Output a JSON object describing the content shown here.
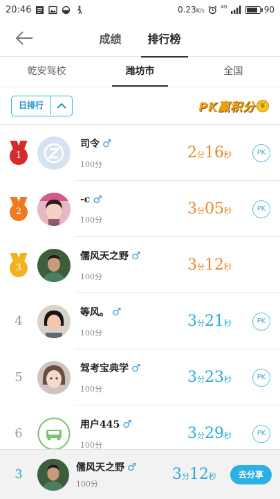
{
  "status_bar": {
    "time": "20:46",
    "speed": "0.23",
    "speed_unit": "K/s",
    "network": "4G",
    "battery": "90",
    "battery_level": 0.9
  },
  "header": {
    "back_icon": "arrow-left-icon",
    "tabs": [
      {
        "label": "成绩",
        "active": false
      },
      {
        "label": "排行榜",
        "active": true
      }
    ]
  },
  "region_tabs": [
    {
      "label": "乾安驾校",
      "active": false
    },
    {
      "label": "潍坊市",
      "active": true
    },
    {
      "label": "全国",
      "active": false
    }
  ],
  "filter": {
    "label": "日排行",
    "arrow_icon": "chevron-up-icon"
  },
  "banner": {
    "text": "PK赢积分",
    "coin": "¥"
  },
  "rankings": [
    {
      "rank": "1",
      "medal": "gold-red",
      "name": "司令",
      "gender_icon": "male-icon",
      "score": "100分",
      "time_num1": "2",
      "time_unit1": "分",
      "time_num2": "16",
      "time_unit2": "秒",
      "time_color": "orange",
      "pk": "PK",
      "avatar": "default-z"
    },
    {
      "rank": "2",
      "medal": "orange",
      "name": "-c",
      "gender_icon": "male-icon",
      "score": "100分",
      "time_num1": "3",
      "time_unit1": "分",
      "time_num2": "05",
      "time_unit2": "秒",
      "time_color": "orange",
      "pk": "PK",
      "avatar": "girl-pink"
    },
    {
      "rank": "3",
      "medal": "gold",
      "name": "儒风天之野",
      "gender_icon": "male-icon",
      "score": "100分",
      "time_num1": "3",
      "time_unit1": "分",
      "time_num2": "12",
      "time_unit2": "秒",
      "time_color": "orange",
      "pk": "",
      "avatar": "man-green"
    },
    {
      "rank": "4",
      "medal": "",
      "name": "等风。",
      "gender_icon": "male-icon",
      "score": "100分",
      "time_num1": "3",
      "time_unit1": "分",
      "time_num2": "21",
      "time_unit2": "秒",
      "time_color": "blue",
      "pk": "PK",
      "avatar": "girl-dark"
    },
    {
      "rank": "5",
      "medal": "",
      "name": "驾考宝典学",
      "gender_icon": "male-icon",
      "score": "100分",
      "time_num1": "3",
      "time_unit1": "分",
      "time_num2": "23",
      "time_unit2": "秒",
      "time_color": "blue",
      "pk": "PK",
      "avatar": "girl-face"
    },
    {
      "rank": "6",
      "medal": "",
      "name": "用户445",
      "gender_icon": "male-icon",
      "score": "100分",
      "time_num1": "3",
      "time_unit1": "分",
      "time_num2": "29",
      "time_unit2": "秒",
      "time_color": "blue",
      "pk": "PK",
      "avatar": "car-icon"
    }
  ],
  "my_rank": {
    "rank": "3",
    "name": "儒风天之野",
    "gender_icon": "male-icon",
    "score": "100分",
    "time_num1": "3",
    "time_unit1": "分",
    "time_num2": "12",
    "time_unit2": "秒",
    "share_label": "去分享"
  },
  "colors": {
    "accent_blue": "#29a9dc",
    "accent_orange": "#e9852b",
    "medal_red": "#d62b2b",
    "medal_orange": "#f07a1f",
    "medal_gold": "#f2b21e"
  }
}
